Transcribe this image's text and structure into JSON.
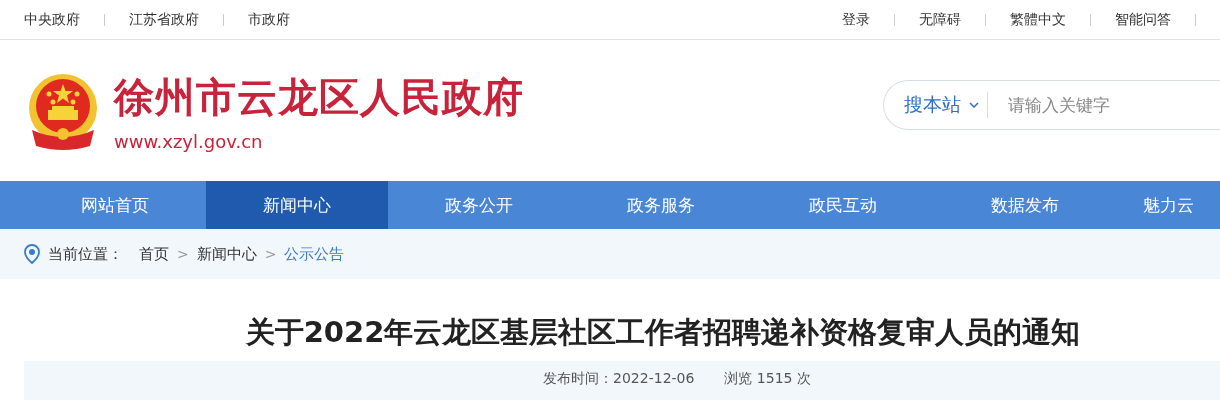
{
  "top_bar": {
    "left_links": [
      "中央政府",
      "江苏省政府",
      "市政府"
    ],
    "right_links": [
      "登录",
      "无障碍",
      "繁體中文",
      "智能问答"
    ]
  },
  "header": {
    "site_name": "徐州市云龙区人民政府",
    "site_url": "www.xzyl.gov.cn",
    "search": {
      "scope": "搜本站",
      "placeholder": "请输入关键字"
    }
  },
  "nav": [
    {
      "label": "网站首页",
      "selected": false
    },
    {
      "label": "新闻中心",
      "selected": true
    },
    {
      "label": "政务公开",
      "selected": false
    },
    {
      "label": "政务服务",
      "selected": false
    },
    {
      "label": "政民互动",
      "selected": false
    },
    {
      "label": "数据发布",
      "selected": false
    },
    {
      "label": "魅力云",
      "selected": false
    }
  ],
  "breadcrumb": {
    "label": "当前位置：",
    "items": [
      {
        "text": "首页",
        "selected": false
      },
      {
        "text": "新闻中心",
        "selected": false
      },
      {
        "text": "公示公告",
        "selected": true
      }
    ],
    "separator": ">"
  },
  "article": {
    "title": "关于2022年云龙区基层社区工作者招聘递补资格复审人员的通知",
    "published": "发布时间：2022-12-06",
    "views": "浏览 1515 次"
  }
}
